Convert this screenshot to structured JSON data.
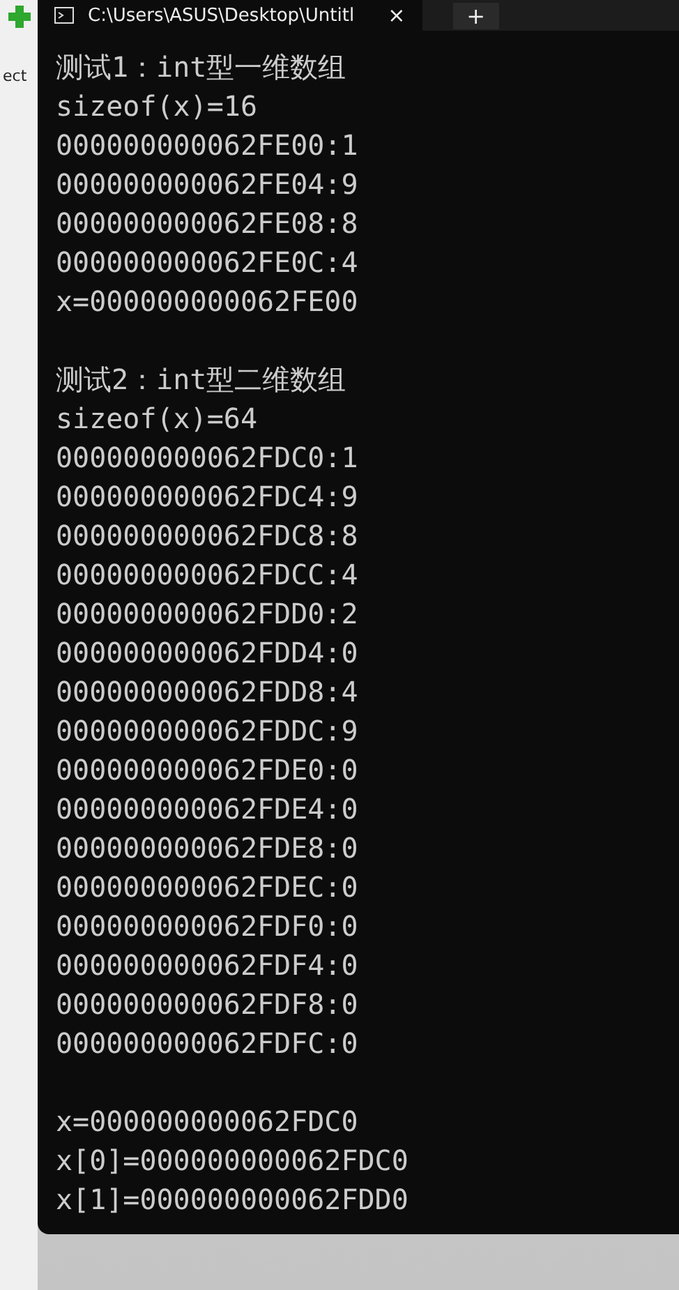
{
  "background_window": {
    "text": "ect"
  },
  "terminal": {
    "tab_title": "C:\\Users\\ASUS\\Desktop\\Untitl",
    "close": "×",
    "new_tab": "+",
    "blocks": [
      [
        "测试1：int型一维数组",
        "sizeof(x)=16",
        "000000000062FE00:1",
        "000000000062FE04:9",
        "000000000062FE08:8",
        "000000000062FE0C:4",
        "x=000000000062FE00"
      ],
      [
        "测试2：int型二维数组",
        "sizeof(x)=64",
        "000000000062FDC0:1",
        "000000000062FDC4:9",
        "000000000062FDC8:8",
        "000000000062FDCC:4",
        "000000000062FDD0:2",
        "000000000062FDD4:0",
        "000000000062FDD8:4",
        "000000000062FDDC:9",
        "000000000062FDE0:0",
        "000000000062FDE4:0",
        "000000000062FDE8:0",
        "000000000062FDEC:0",
        "000000000062FDF0:0",
        "000000000062FDF4:0",
        "000000000062FDF8:0",
        "000000000062FDFC:0"
      ],
      [
        "x=000000000062FDC0",
        "x[0]=000000000062FDC0",
        "x[1]=000000000062FDD0"
      ]
    ]
  }
}
